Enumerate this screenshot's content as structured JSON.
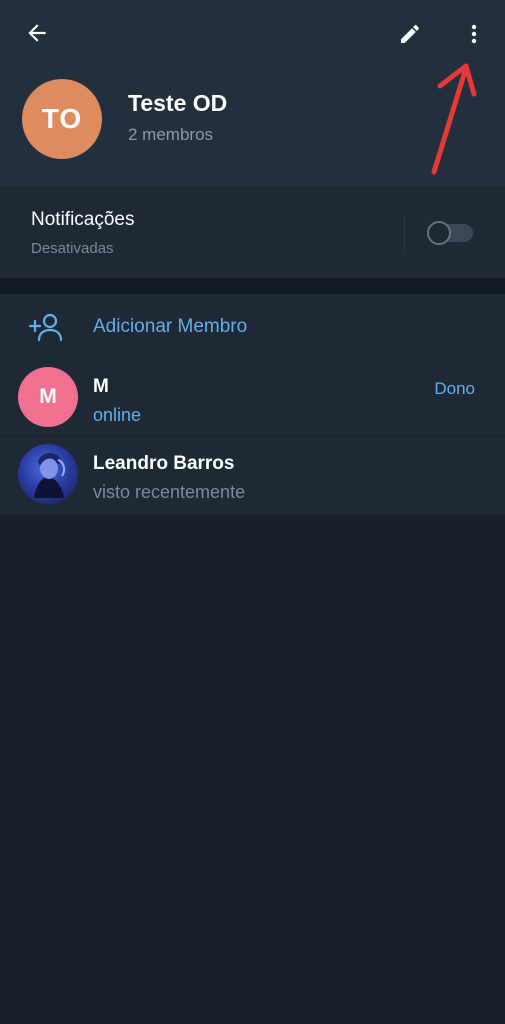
{
  "header": {
    "back_icon": "arrow-left-icon",
    "edit_icon": "pencil-icon",
    "more_icon": "more-vertical-icon"
  },
  "group": {
    "avatar_initials": "TO",
    "avatar_color": "#dd8c5f",
    "title": "Teste OD",
    "subtitle": "2 membros"
  },
  "notifications": {
    "title": "Notificações",
    "status": "Desativadas",
    "enabled": false
  },
  "members": {
    "add_label": "Adicionar Membro",
    "add_icon": "add-user-icon",
    "list": [
      {
        "avatar_initials": "M",
        "avatar_color": "#f1708f",
        "name": "M",
        "status": "online",
        "role": "Dono"
      },
      {
        "avatar_type": "photo",
        "name": "Leandro Barros",
        "status": "visto recentemente",
        "role": ""
      }
    ]
  },
  "colors": {
    "accent": "#62b0e8",
    "header_bg": "#232f3d",
    "section_bg": "#1e2935",
    "page_bg": "#18202a",
    "annotation": "#e53935"
  }
}
